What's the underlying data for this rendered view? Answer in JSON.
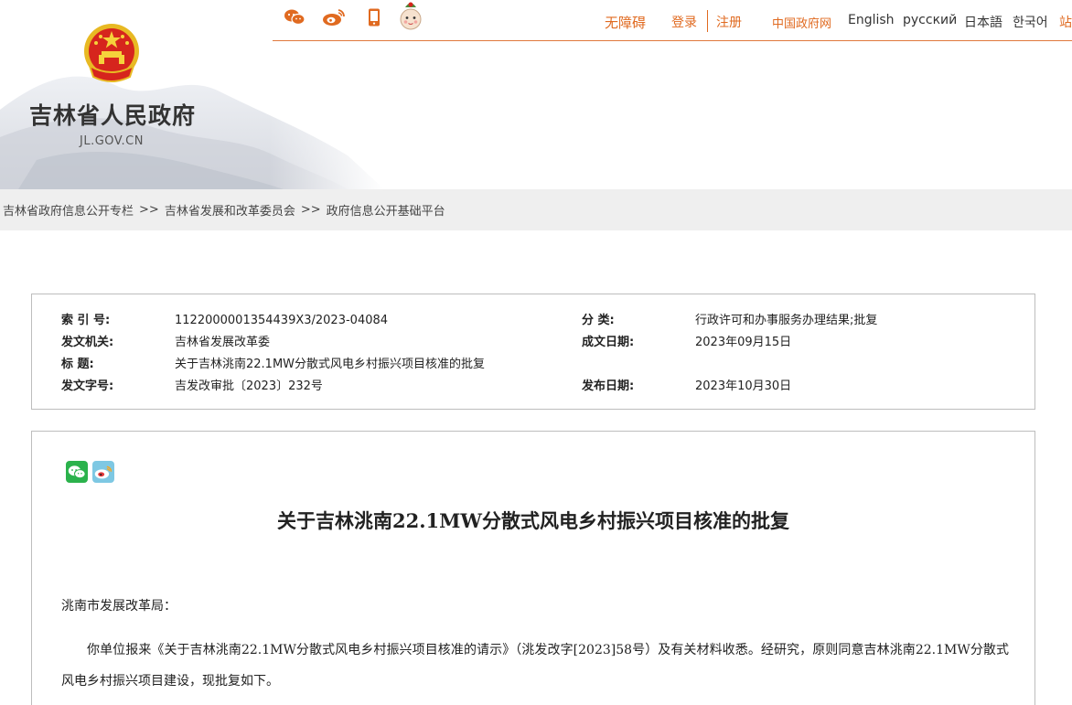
{
  "header": {
    "site_name": "吉林省人民政府",
    "site_domain": "JL.GOV.CN",
    "icons": [
      "wechat-icon",
      "weibo-icon",
      "mobile-icon",
      "mascot-icon"
    ],
    "links": {
      "accessibility": "无障碍",
      "login": "登录",
      "register": "注册",
      "gov_portal": "中国政府网",
      "english": "English",
      "russian": "русский",
      "japanese": "日本語",
      "korean": "한국어",
      "more": "站"
    },
    "accent_color": "#e06a20"
  },
  "breadcrumb": [
    "吉林省政府信息公开专栏",
    "吉林省发展和改革委员会",
    "政府信息公开基础平台"
  ],
  "breadcrumb_separator": ">>",
  "info": {
    "index_label": "索 引 号:",
    "index_value": "1122000001354439X3/2023-04084",
    "category_label": "分 类:",
    "category_value": "行政许可和办事服务办理结果;批复",
    "issuer_label": "发文机关:",
    "issuer_value": "吉林省发展改革委",
    "written_date_label": "成文日期:",
    "written_date_value": "2023年09月15日",
    "title_label": "标 题:",
    "title_value": "关于吉林洮南22.1MW分散式风电乡村振兴项目核准的批复",
    "doc_number_label": "发文字号:",
    "doc_number_value": "吉发改审批〔2023〕232号",
    "publish_date_label": "发布日期:",
    "publish_date_value": "2023年10月30日"
  },
  "article": {
    "share_icons": [
      "wechat-share-icon",
      "weibo-share-icon"
    ],
    "title": "关于吉林洮南22.1MW分散式风电乡村振兴项目核准的批复",
    "addressee": "洮南市发展改革局：",
    "paragraph1": "你单位报来《关于吉林洮南22.1MW分散式风电乡村振兴项目核准的请示》（洮发改字[2023]58号）及有关材料收悉。经研究，原则同意吉林洮南22.1MW分散式风电乡村振兴项目建设，现批复如下。"
  }
}
